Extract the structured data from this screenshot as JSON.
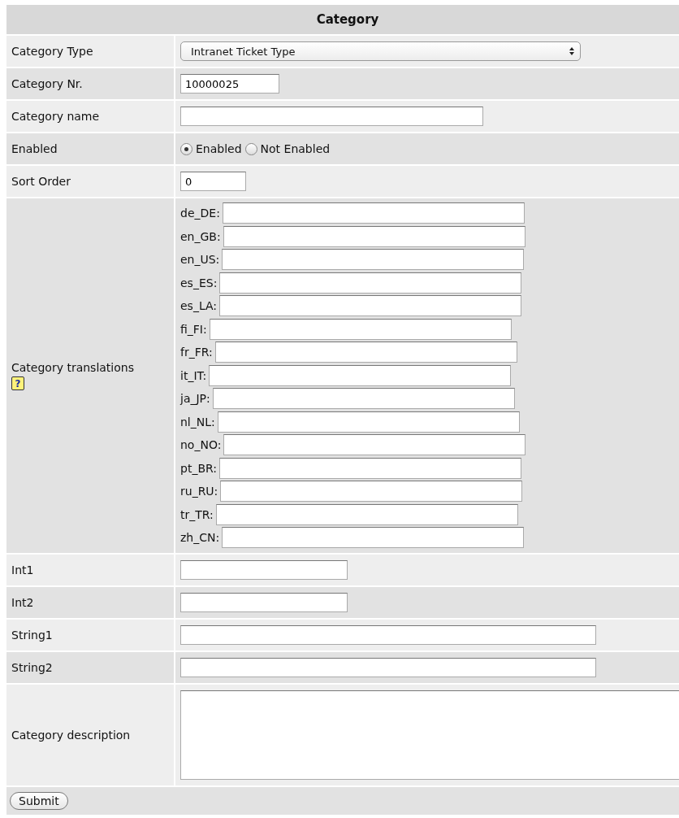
{
  "form": {
    "title": "Category",
    "rows": [
      {
        "kind": "select",
        "label": "Category Type",
        "value": "Intranet Ticket Type"
      },
      {
        "kind": "text",
        "label": "Category Nr.",
        "value": "10000025"
      },
      {
        "kind": "text",
        "label": "Category name"
      },
      {
        "kind": "radio",
        "label": "Enabled",
        "options": [
          {
            "label": "Enabled",
            "selected": true
          },
          {
            "label": "Not Enabled",
            "selected": false
          }
        ]
      },
      {
        "kind": "text",
        "label": "Sort Order",
        "value": "0"
      },
      {
        "kind": "translations",
        "label": "Category translations",
        "help_icon": "?",
        "languages": [
          {
            "label": "de_DE:"
          },
          {
            "label": "en_GB:"
          },
          {
            "label": "en_US:"
          },
          {
            "label": "es_ES:"
          },
          {
            "label": "es_LA:"
          },
          {
            "label": "fi_FI:"
          },
          {
            "label": "fr_FR:"
          },
          {
            "label": "it_IT:"
          },
          {
            "label": "ja_JP:"
          },
          {
            "label": "nl_NL:"
          },
          {
            "label": "no_NO:"
          },
          {
            "label": "pt_BR:"
          },
          {
            "label": "ru_RU:"
          },
          {
            "label": "tr_TR:"
          },
          {
            "label": "zh_CN:"
          }
        ]
      },
      {
        "kind": "text",
        "label": "Int1"
      },
      {
        "kind": "text",
        "label": "Int2"
      },
      {
        "kind": "text",
        "label": "String1"
      },
      {
        "kind": "text",
        "label": "String2"
      },
      {
        "kind": "textarea",
        "label": "Category description"
      }
    ],
    "submit": "Submit"
  }
}
